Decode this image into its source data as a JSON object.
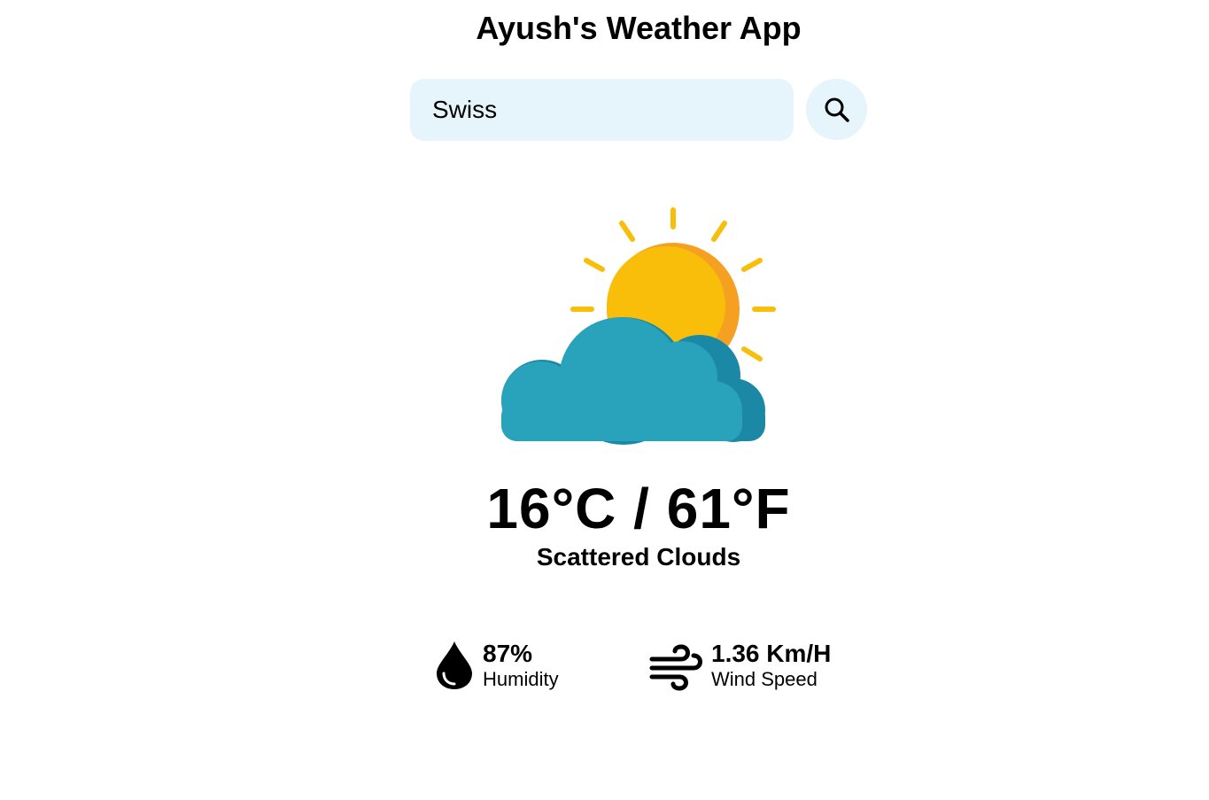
{
  "app": {
    "title": "Ayush's Weather App"
  },
  "search": {
    "value": "Swiss",
    "placeholder": "Search"
  },
  "weather": {
    "icon": "sun-behind-cloud-icon",
    "temperature": "16°C / 61°F",
    "description": "Scattered Clouds"
  },
  "stats": {
    "humidity": {
      "icon": "water-drop-icon",
      "value": "87%",
      "label": "Humidity"
    },
    "wind": {
      "icon": "wind-icon",
      "value": "1.36 Km/H",
      "label": "Wind Speed"
    }
  },
  "colors": {
    "search_background": "#e6f4fb",
    "sun": "#f9be09",
    "sun_shade": "#f5a020",
    "cloud": "#29a3bb",
    "cloud_shade": "#1b88a6"
  }
}
